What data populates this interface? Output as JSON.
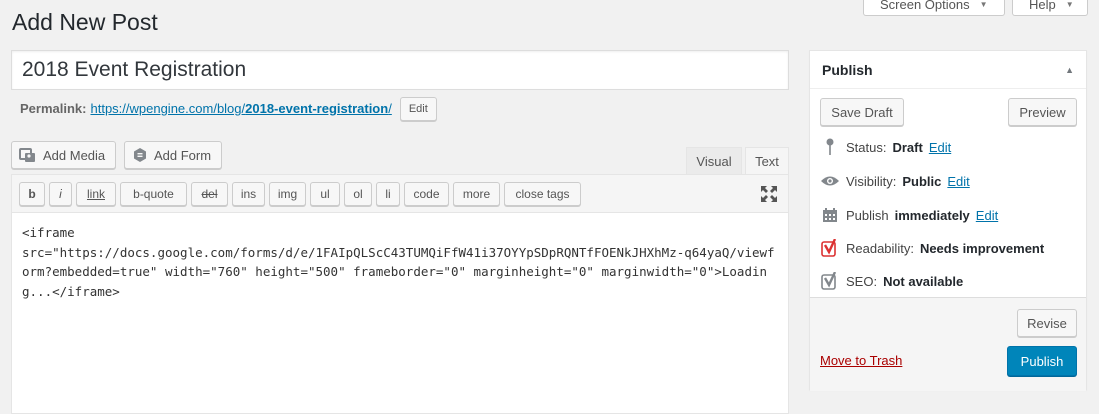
{
  "header": {
    "title": "Add New Post",
    "screen_options_label": "Screen Options",
    "help_label": "Help"
  },
  "post": {
    "title_value": "2018 Event Registration",
    "permalink_label": "Permalink:",
    "permalink_base": "https://wpengine.com/blog/",
    "permalink_slug": "2018-event-registration",
    "permalink_trailing": "/",
    "permalink_edit_label": "Edit"
  },
  "media": {
    "add_media_label": "Add Media",
    "add_form_label": "Add Form"
  },
  "editor": {
    "tabs": {
      "visual": "Visual",
      "text": "Text"
    },
    "active_tab": "Text",
    "quicktags": [
      "b",
      "i",
      "link",
      "b-quote",
      "del",
      "ins",
      "img",
      "ul",
      "ol",
      "li",
      "code",
      "more",
      "close tags"
    ],
    "content": "<iframe\nsrc=\"https://docs.google.com/forms/d/e/1FAIpQLScC43TUMQiFfW41i37OYYpSDpRQNTfFOENkJHXhMz-q64yaQ/viewform?embedded=true\" width=\"760\" height=\"500\" frameborder=\"0\" marginheight=\"0\" marginwidth=\"0\">Loading...</iframe>"
  },
  "publish_box": {
    "title": "Publish",
    "save_draft_label": "Save Draft",
    "preview_label": "Preview",
    "status_label": "Status:",
    "status_value": "Draft",
    "visibility_label": "Visibility:",
    "visibility_value": "Public",
    "publish_label": "Publish",
    "publish_value": "immediately",
    "readability_label": "Readability:",
    "readability_value": "Needs improvement",
    "seo_label": "SEO:",
    "seo_value": "Not available",
    "edit_label": "Edit",
    "revise_label": "Revise",
    "trash_label": "Move to Trash",
    "publish_button_label": "Publish"
  },
  "colors": {
    "accent": "#0085ba",
    "link": "#0073aa",
    "trash": "#a00000",
    "yoast_bad": "#dc3232"
  }
}
